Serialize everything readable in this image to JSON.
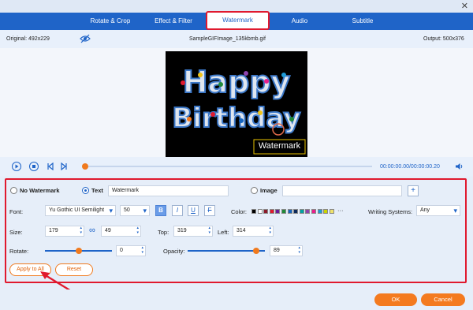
{
  "window": {
    "close_glyph": "✕"
  },
  "tabs": [
    "Rotate & Crop",
    "Effect & Filter",
    "Watermark",
    "Audio",
    "Subtitle"
  ],
  "info": {
    "original": "Original: 492x229",
    "filename": "SampleGIFImage_135kbmb.gif",
    "output": "Output: 500x376"
  },
  "preview": {
    "line1": "Happy",
    "line2": "Birthday",
    "watermark_text": "Watermark"
  },
  "player": {
    "time": "00:00:00.00/00:00:00.20",
    "progress": 0.0
  },
  "watermark": {
    "no_watermark_label": "No Watermark",
    "text_label": "Text",
    "text_value": "Watermark",
    "image_label": "Image",
    "image_value": "",
    "add_glyph": "+"
  },
  "font": {
    "label": "Font:",
    "family": "Yu Gothic UI Semilight",
    "size": "50",
    "bold": "B",
    "italic": "I",
    "underline": "U",
    "strike": "F",
    "color_label": "Color:",
    "colors": [
      "#000000",
      "#ffffff",
      "#8b1a2b",
      "#e0192e",
      "#6a1b9a",
      "#1f8a3a",
      "#1565c0",
      "#0d2a5c",
      "#00a3a3",
      "#8e44ad",
      "#e91e8c",
      "#1e9bd7",
      "#c9d400",
      "#f0e36a"
    ],
    "more": "···",
    "writing_label": "Writing Systems:",
    "writing_value": "Any"
  },
  "size": {
    "label": "Size:",
    "width": "179",
    "link_glyph": "∞",
    "height": "49",
    "top_label": "Top:",
    "top": "319",
    "left_label": "Left:",
    "left": "314"
  },
  "rotate": {
    "label": "Rotate:",
    "value": "0",
    "level": 0.5
  },
  "opacity": {
    "label": "Opacity:",
    "value": "89",
    "level": 0.89
  },
  "buttons": {
    "apply_all": "Apply to All",
    "reset": "Reset",
    "ok": "OK",
    "cancel": "Cancel"
  },
  "colors": {
    "accent": "#1f64c8",
    "orange": "#f47a1f",
    "highlight": "#e0192e"
  }
}
